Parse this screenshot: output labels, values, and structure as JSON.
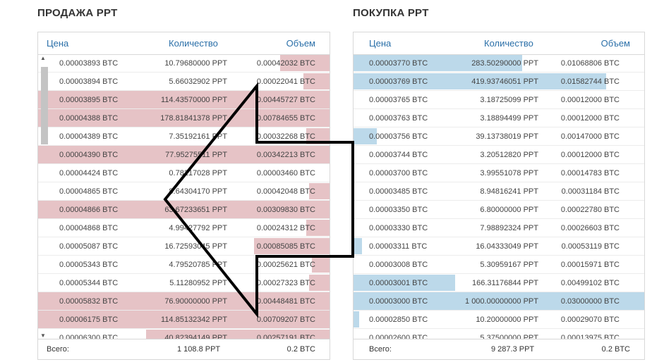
{
  "sell": {
    "title": "ПРОДАЖА PPT",
    "headers": {
      "price": "Цена",
      "qty": "Количество",
      "vol": "Объем"
    },
    "rows": [
      {
        "price": "0.00003893 BTC",
        "qty": "10.79680000 PPT",
        "vol": "0.00042032 BTC",
        "fill": 0.17,
        "full": false
      },
      {
        "price": "0.00003894 BTC",
        "qty": "5.66032902 PPT",
        "vol": "0.00022041 BTC",
        "fill": 0.09,
        "full": false
      },
      {
        "price": "0.00003895 BTC",
        "qty": "114.43570000 PPT",
        "vol": "0.00445727 BTC",
        "fill": 1,
        "full": true
      },
      {
        "price": "0.00004388 BTC",
        "qty": "178.81841378 PPT",
        "vol": "0.00784655 BTC",
        "fill": 1,
        "full": true
      },
      {
        "price": "0.00004389 BTC",
        "qty": "7.35192161 PPT",
        "vol": "0.00032268 BTC",
        "fill": 0.08,
        "full": false
      },
      {
        "price": "0.00004390 BTC",
        "qty": "77.95275511 PPT",
        "vol": "0.00342213 BTC",
        "fill": 1,
        "full": true
      },
      {
        "price": "0.00004424 BTC",
        "qty": "0.78217028 PPT",
        "vol": "0.00003460 BTC",
        "fill": 0,
        "full": false
      },
      {
        "price": "0.00004865 BTC",
        "qty": "8.64304170 PPT",
        "vol": "0.00042048 BTC",
        "fill": 0.07,
        "full": false
      },
      {
        "price": "0.00004866 BTC",
        "qty": "63.67233651 PPT",
        "vol": "0.00309830 BTC",
        "fill": 1,
        "full": true
      },
      {
        "price": "0.00004868 BTC",
        "qty": "4.99427792 PPT",
        "vol": "0.00024312 BTC",
        "fill": 0.08,
        "full": false
      },
      {
        "price": "0.00005087 BTC",
        "qty": "16.72593045 PPT",
        "vol": "0.00085085 BTC",
        "fill": 0.26,
        "full": false
      },
      {
        "price": "0.00005343 BTC",
        "qty": "4.79520785 PPT",
        "vol": "0.00025621 BTC",
        "fill": 0.06,
        "full": false
      },
      {
        "price": "0.00005344 BTC",
        "qty": "5.11280952 PPT",
        "vol": "0.00027323 BTC",
        "fill": 0.07,
        "full": false
      },
      {
        "price": "0.00005832 BTC",
        "qty": "76.90000000 PPT",
        "vol": "0.00448481 BTC",
        "fill": 1,
        "full": true
      },
      {
        "price": "0.00006175 BTC",
        "qty": "114.85132342 PPT",
        "vol": "0.00709207 BTC",
        "fill": 1,
        "full": true
      },
      {
        "price": "0.00006300 BTC",
        "qty": "40.82394149 PPT",
        "vol": "0.00257191 BTC",
        "fill": 0.63,
        "full": false
      }
    ],
    "footer": {
      "label": "Всего:",
      "qty": "1 108.8 PPT",
      "vol": "0.2 BTC"
    }
  },
  "buy": {
    "title": "ПОКУПКА PPT",
    "headers": {
      "price": "Цена",
      "qty": "Количество",
      "vol": "Объем"
    },
    "rows": [
      {
        "price": "0.00003770 BTC",
        "qty": "283.50290000 PPT",
        "vol": "0.01068806 BTC",
        "fill": 0.58
      },
      {
        "price": "0.00003769 BTC",
        "qty": "419.93746051 PPT",
        "vol": "0.01582744 BTC",
        "fill": 0.87
      },
      {
        "price": "0.00003765 BTC",
        "qty": "3.18725099 PPT",
        "vol": "0.00012000 BTC",
        "fill": 0
      },
      {
        "price": "0.00003763 BTC",
        "qty": "3.18894499 PPT",
        "vol": "0.00012000 BTC",
        "fill": 0
      },
      {
        "price": "0.00003756 BTC",
        "qty": "39.13738019 PPT",
        "vol": "0.00147000 BTC",
        "fill": 0.08
      },
      {
        "price": "0.00003744 BTC",
        "qty": "3.20512820 PPT",
        "vol": "0.00012000 BTC",
        "fill": 0
      },
      {
        "price": "0.00003700 BTC",
        "qty": "3.99551078 PPT",
        "vol": "0.00014783 BTC",
        "fill": 0
      },
      {
        "price": "0.00003485 BTC",
        "qty": "8.94816241 PPT",
        "vol": "0.00031184 BTC",
        "fill": 0
      },
      {
        "price": "0.00003350 BTC",
        "qty": "6.80000000 PPT",
        "vol": "0.00022780 BTC",
        "fill": 0
      },
      {
        "price": "0.00003330 BTC",
        "qty": "7.98892324 PPT",
        "vol": "0.00026603 BTC",
        "fill": 0
      },
      {
        "price": "0.00003311 BTC",
        "qty": "16.04333049 PPT",
        "vol": "0.00053119 BTC",
        "fill": 0.03
      },
      {
        "price": "0.00003008 BTC",
        "qty": "5.30959167 PPT",
        "vol": "0.00015971 BTC",
        "fill": 0
      },
      {
        "price": "0.00003001 BTC",
        "qty": "166.31176844 PPT",
        "vol": "0.00499102 BTC",
        "fill": 0.35
      },
      {
        "price": "0.00003000 BTC",
        "qty": "1 000.00000000 PPT",
        "vol": "0.03000000 BTC",
        "fill": 1
      },
      {
        "price": "0.00002850 BTC",
        "qty": "10.20000000 PPT",
        "vol": "0.00029070 BTC",
        "fill": 0.02
      },
      {
        "price": "0.00002600 BTC",
        "qty": "5.37500000 PPT",
        "vol": "0.00013975 BTC",
        "fill": 0
      }
    ],
    "footer": {
      "label": "Всего:",
      "qty": "9 287.3 PPT",
      "vol": "0.2 BTC"
    }
  },
  "colors": {
    "sell_bar": "#e6c3c6",
    "buy_bar": "#bcd9ea",
    "header_text": "#2a6fa8"
  },
  "icons": {
    "scroll_up": "triangle-up",
    "scroll_down": "triangle-down",
    "overlay": "left-arrow-outline"
  }
}
